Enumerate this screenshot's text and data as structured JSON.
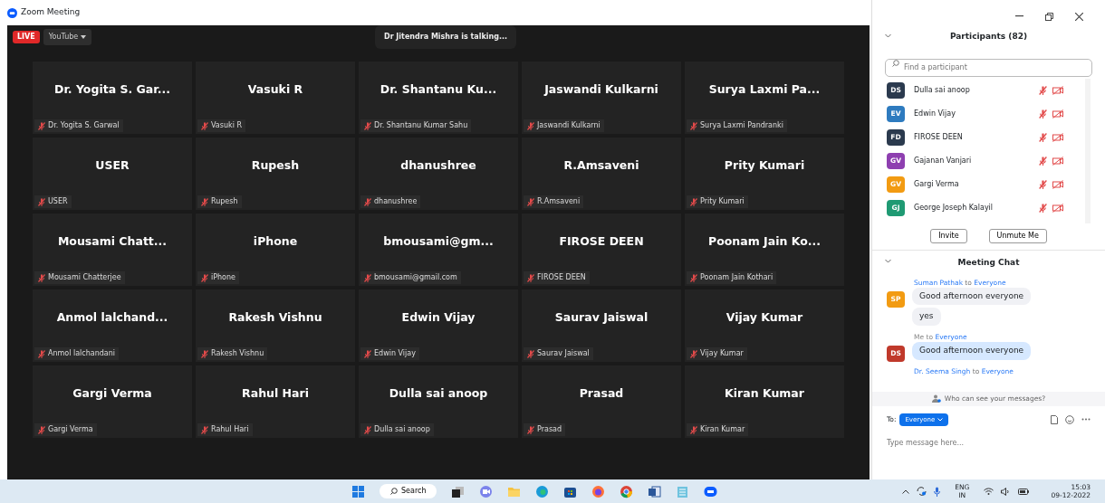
{
  "window": {
    "title": "Zoom Meeting"
  },
  "live_badge": "LIVE",
  "stream_target": "YouTube",
  "talking": "Dr Jitendra Mishra is talking...",
  "tiles": [
    {
      "display": "Dr. Yogita S. Gar...",
      "name": "Dr. Yogita S. Garwal",
      "muted": true
    },
    {
      "display": "Vasuki R",
      "name": "Vasuki R",
      "muted": true
    },
    {
      "display": "Dr. Shantanu Ku...",
      "name": "Dr. Shantanu Kumar Sahu",
      "muted": true
    },
    {
      "display": "Jaswandi Kulkarni",
      "name": "Jaswandi Kulkarni",
      "muted": true
    },
    {
      "display": "Surya Laxmi Pa...",
      "name": "Surya Laxmi Pandranki",
      "muted": true
    },
    {
      "display": "USER",
      "name": "USER",
      "muted": true
    },
    {
      "display": "Rupesh",
      "name": "Rupesh",
      "muted": true
    },
    {
      "display": "dhanushree",
      "name": "dhanushree",
      "muted": true
    },
    {
      "display": "R.Amsaveni",
      "name": "R.Amsaveni",
      "muted": true
    },
    {
      "display": "Prity Kumari",
      "name": "Prity Kumari",
      "muted": true
    },
    {
      "display": "Mousami Chatt...",
      "name": "Mousami Chatterjee",
      "muted": true
    },
    {
      "display": "iPhone",
      "name": "iPhone",
      "muted": true
    },
    {
      "display": "bmousami@gm...",
      "name": "bmousami@gmail.com",
      "muted": true
    },
    {
      "display": "FIROSE DEEN",
      "name": "FIROSE DEEN",
      "muted": true
    },
    {
      "display": "Poonam Jain Ko...",
      "name": "Poonam Jain Kothari",
      "muted": true
    },
    {
      "display": "Anmol lalchand...",
      "name": "Anmol lalchandani",
      "muted": true
    },
    {
      "display": "Rakesh Vishnu",
      "name": "Rakesh Vishnu",
      "muted": true
    },
    {
      "display": "Edwin Vijay",
      "name": "Edwin Vijay",
      "muted": true
    },
    {
      "display": "Saurav Jaiswal",
      "name": "Saurav Jaiswal",
      "muted": true
    },
    {
      "display": "Vijay Kumar",
      "name": "Vijay Kumar",
      "muted": true
    },
    {
      "display": "Gargi Verma",
      "name": "Gargi Verma",
      "muted": true
    },
    {
      "display": "Rahul Hari",
      "name": "Rahul Hari",
      "muted": true
    },
    {
      "display": "Dulla sai anoop",
      "name": "Dulla sai anoop",
      "muted": true
    },
    {
      "display": "Prasad",
      "name": "Prasad",
      "muted": true
    },
    {
      "display": "Kiran Kumar",
      "name": "Kiran Kumar",
      "muted": true
    }
  ],
  "participants": {
    "title": "Participants (82)",
    "search": {
      "placeholder": "Find a participant"
    },
    "items": [
      {
        "initials": "DS",
        "name": "Dulla sai anoop",
        "color": "#2b3a4e",
        "muted": true,
        "video_off": true
      },
      {
        "initials": "EV",
        "name": "Edwin Vijay",
        "color": "#2e7bbf",
        "muted": true,
        "video_off": true
      },
      {
        "initials": "FD",
        "name": "FIROSE DEEN",
        "color": "#2b3a4e",
        "muted": true,
        "video_off": true
      },
      {
        "initials": "GV",
        "name": "Gajanan Vanjari",
        "color": "#8e3fb0",
        "muted": true,
        "video_off": true
      },
      {
        "initials": "GV",
        "name": "Gargi Verma",
        "color": "#f29b12",
        "muted": true,
        "video_off": true
      },
      {
        "initials": "GJ",
        "name": "George Joseph Kalayil",
        "color": "#1f9a73",
        "muted": true,
        "video_off": true
      }
    ],
    "buttons": [
      "Invite",
      "Unmute Me"
    ]
  },
  "chat": {
    "title": "Meeting Chat",
    "messages": [
      {
        "sender": "Suman Pathak",
        "to": "to",
        "recipient": "Everyone",
        "initials": "SP",
        "color": "#f29b12",
        "mine": false,
        "bubbles": [
          "Good afternoon everyone",
          "yes"
        ]
      },
      {
        "sender": "Me",
        "to": "to",
        "recipient": "Everyone",
        "initials": "DS",
        "color": "#c0392b",
        "mine": true,
        "bubbles": [
          "Good afternoon everyone"
        ]
      },
      {
        "sender": "Dr. Seema Singh",
        "to": "to",
        "recipient": "Everyone",
        "mine": false
      }
    ],
    "visibility_note": "Who can see your messages?",
    "to_label": "To:",
    "recipient": "Everyone",
    "placeholder": "Type message here..."
  },
  "taskbar": {
    "search": "Search",
    "lang": "ENG",
    "region": "IN",
    "time": "15:03",
    "date": "09-12-2022"
  }
}
